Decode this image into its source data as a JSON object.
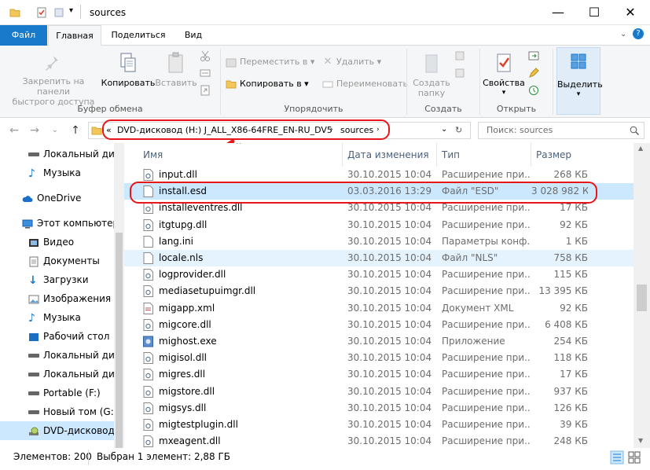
{
  "window": {
    "title": "sources"
  },
  "ribbon": {
    "tabs": [
      {
        "label": "Файл"
      },
      {
        "label": "Главная"
      },
      {
        "label": "Поделиться"
      },
      {
        "label": "Вид"
      }
    ],
    "clipboard": {
      "pin_label_1": "Закрепить на панели",
      "pin_label_2": "быстрого доступа",
      "copy_label": "Копировать",
      "paste_label": "Вставить",
      "group_label": "Буфер обмена"
    },
    "organize": {
      "move_label": "Переместить в",
      "copy_to_label": "Копировать в",
      "delete_label": "Удалить",
      "rename_label": "Переименовать",
      "group_label": "Упорядочить"
    },
    "create": {
      "new_folder_1": "Создать",
      "new_folder_2": "папку",
      "group_label": "Создать"
    },
    "open": {
      "properties_label": "Свойства",
      "group_label": "Открыть"
    },
    "select": {
      "select_label": "Выделить"
    }
  },
  "address": {
    "chevron": "«",
    "drive": "DVD-дисковод (H:) J_ALL_X86-64FRE_EN-RU_DV5",
    "folder": "sources",
    "search_placeholder": "Поиск: sources"
  },
  "nav": {
    "items": [
      {
        "label": "Локальный дис"
      },
      {
        "label": "Музыка"
      },
      {
        "label": "OneDrive"
      },
      {
        "label": "Этот компьютер"
      },
      {
        "label": "Видео"
      },
      {
        "label": "Документы"
      },
      {
        "label": "Загрузки"
      },
      {
        "label": "Изображения"
      },
      {
        "label": "Музыка"
      },
      {
        "label": "Рабочий стол"
      },
      {
        "label": "Локальный дис"
      },
      {
        "label": "Локальный дис"
      },
      {
        "label": "Portable (F:)"
      },
      {
        "label": "Новый том (G:)"
      },
      {
        "label": "DVD-дисковод ("
      }
    ]
  },
  "columns": {
    "name": "Имя",
    "date": "Дата изменения",
    "type": "Тип",
    "size": "Размер"
  },
  "files": [
    {
      "name": "input.dll",
      "date": "30.10.2015 10:04",
      "type": "Расширение при...",
      "size": "268 КБ"
    },
    {
      "name": "install.esd",
      "date": "03.03.2016 13:29",
      "type": "Файл \"ESD\"",
      "size": "3 028 982 КБ"
    },
    {
      "name": "installeventres.dll",
      "date": "30.10.2015 10:04",
      "type": "Расширение при...",
      "size": "17 КБ"
    },
    {
      "name": "itgtupg.dll",
      "date": "30.10.2015 10:04",
      "type": "Расширение при...",
      "size": "92 КБ"
    },
    {
      "name": "lang.ini",
      "date": "30.10.2015 10:04",
      "type": "Параметры конф...",
      "size": "1 КБ"
    },
    {
      "name": "locale.nls",
      "date": "30.10.2015 10:04",
      "type": "Файл \"NLS\"",
      "size": "758 КБ"
    },
    {
      "name": "logprovider.dll",
      "date": "30.10.2015 10:04",
      "type": "Расширение при...",
      "size": "115 КБ"
    },
    {
      "name": "mediasetupuimgr.dll",
      "date": "30.10.2015 10:04",
      "type": "Расширение при...",
      "size": "13 395 КБ"
    },
    {
      "name": "migapp.xml",
      "date": "30.10.2015 10:04",
      "type": "Документ XML",
      "size": "92 КБ"
    },
    {
      "name": "migcore.dll",
      "date": "30.10.2015 10:04",
      "type": "Расширение при...",
      "size": "6 408 КБ"
    },
    {
      "name": "mighost.exe",
      "date": "30.10.2015 10:04",
      "type": "Приложение",
      "size": "254 КБ"
    },
    {
      "name": "migisol.dll",
      "date": "30.10.2015 10:04",
      "type": "Расширение при...",
      "size": "118 КБ"
    },
    {
      "name": "migres.dll",
      "date": "30.10.2015 10:04",
      "type": "Расширение при...",
      "size": "17 КБ"
    },
    {
      "name": "migstore.dll",
      "date": "30.10.2015 10:04",
      "type": "Расширение при...",
      "size": "937 КБ"
    },
    {
      "name": "migsys.dll",
      "date": "30.10.2015 10:04",
      "type": "Расширение при...",
      "size": "126 КБ"
    },
    {
      "name": "migtestplugin.dll",
      "date": "30.10.2015 10:04",
      "type": "Расширение при...",
      "size": "39 КБ"
    },
    {
      "name": "mxeagent.dll",
      "date": "30.10.2015 10:04",
      "type": "Расширение при...",
      "size": "248 КБ"
    }
  ],
  "status": {
    "count": "Элементов: 200",
    "selection": "Выбран 1 элемент: 2,88 ГБ"
  },
  "colors": {
    "accent": "#1979ca",
    "selection": "#cce8ff",
    "highlight": "#e8151b"
  }
}
